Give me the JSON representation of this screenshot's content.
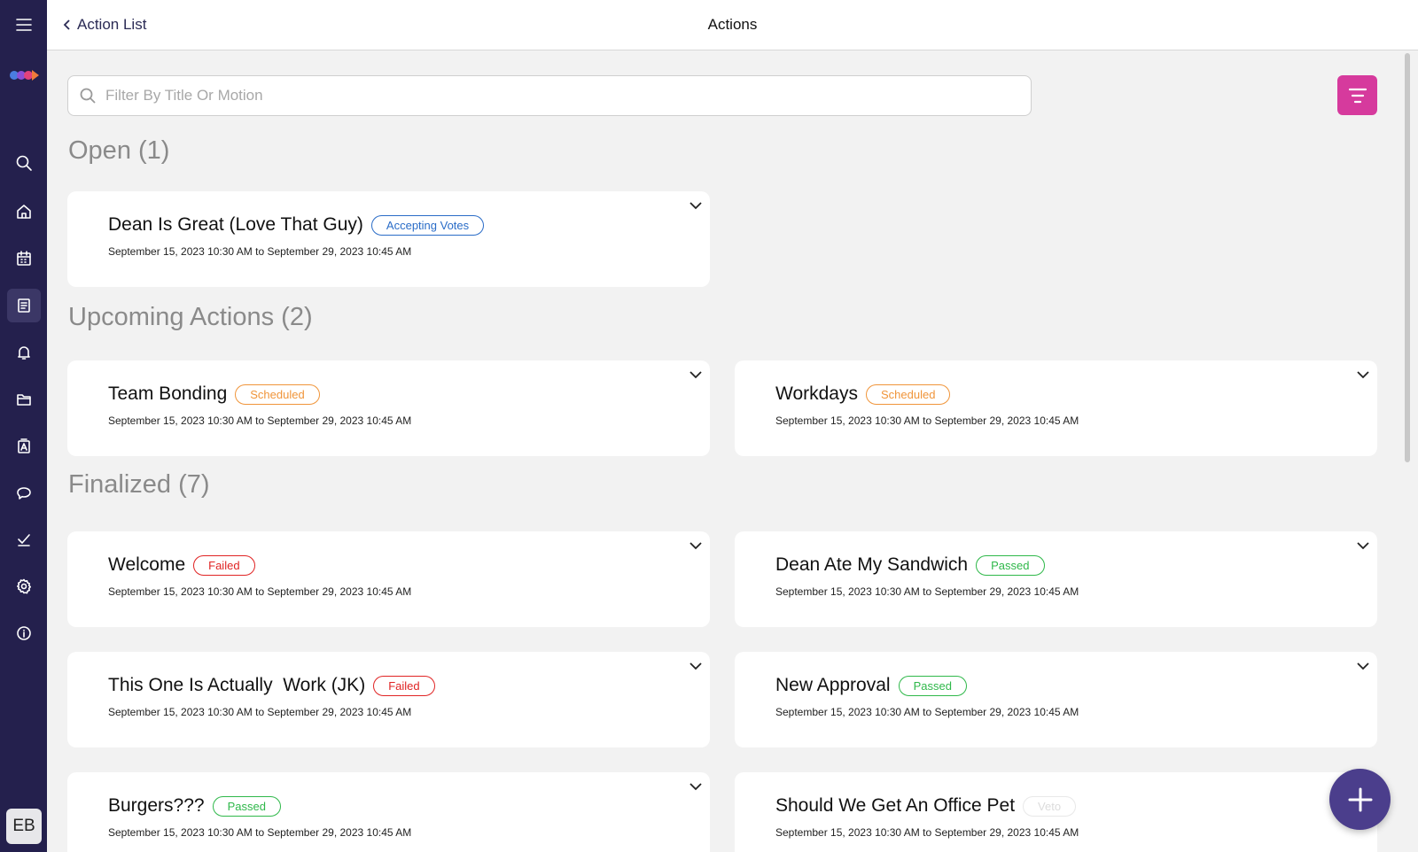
{
  "header": {
    "back_label": "Action List",
    "title": "Actions"
  },
  "search": {
    "placeholder": "Filter By Title Or Motion"
  },
  "user": {
    "initials": "EB"
  },
  "colors": {
    "sidebar": "#24204d",
    "accent_filter": "#d63a9d",
    "fab": "#4b3e8c",
    "accepting": "#2a6cc7",
    "scheduled": "#f0953a",
    "failed": "#e02424",
    "passed": "#2fb84a"
  },
  "sidebar_icons": [
    "menu-icon",
    "logo-icon",
    "search-icon",
    "home-icon",
    "calendar-icon",
    "actions-list-icon",
    "bell-icon",
    "folder-icon",
    "ballot-icon",
    "chat-icon",
    "check-icon",
    "gear-icon",
    "info-icon"
  ],
  "sections": [
    {
      "title": "Open (1)",
      "cards": [
        {
          "title": "Dean Is Great (Love That Guy)",
          "status": "Accepting Votes",
          "status_type": "accepting",
          "dates": "September 15, 2023 10:30 AM to September 29, 2023 10:45 AM"
        }
      ]
    },
    {
      "title": "Upcoming Actions (2)",
      "cards": [
        {
          "title": "Team Bonding",
          "status": "Scheduled",
          "status_type": "scheduled",
          "dates": "September 15, 2023 10:30 AM to September 29, 2023 10:45 AM"
        },
        {
          "title": "Workdays",
          "status": "Scheduled",
          "status_type": "scheduled",
          "dates": "September 15, 2023 10:30 AM to September 29, 2023 10:45 AM"
        }
      ]
    },
    {
      "title": "Finalized (7)",
      "cards": [
        {
          "title": "Welcome",
          "status": "Failed",
          "status_type": "failed",
          "dates": "September 15, 2023 10:30 AM to September 29, 2023 10:45 AM"
        },
        {
          "title": "Dean Ate My Sandwich",
          "status": "Passed",
          "status_type": "passed",
          "dates": "September 15, 2023 10:30 AM to September 29, 2023 10:45 AM"
        },
        {
          "title": "This One Is Actually  Work (JK)",
          "status": "Failed",
          "status_type": "failed",
          "dates": "September 15, 2023 10:30 AM to September 29, 2023 10:45 AM"
        },
        {
          "title": "New Approval",
          "status": "Passed",
          "status_type": "passed",
          "dates": "September 15, 2023 10:30 AM to September 29, 2023 10:45 AM"
        },
        {
          "title": "Burgers???",
          "status": "Passed",
          "status_type": "passed",
          "dates": "September 15, 2023 10:30 AM to September 29, 2023 10:45 AM"
        },
        {
          "title": "Should We Get An Office Pet",
          "status": "Veto",
          "status_type": "veto",
          "dates": "September 15, 2023 10:30 AM to September 29, 2023 10:45 AM"
        }
      ]
    }
  ]
}
